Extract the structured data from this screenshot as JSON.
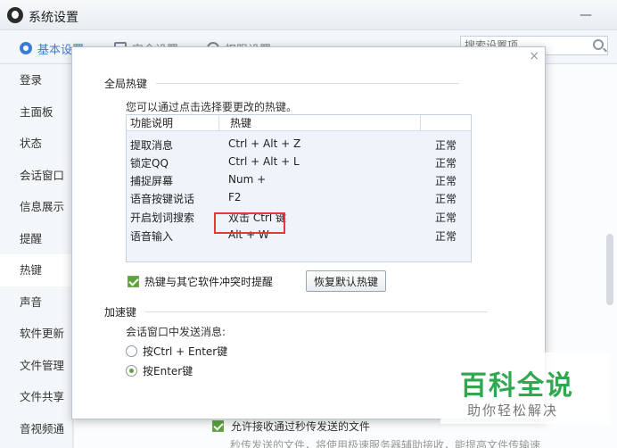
{
  "window": {
    "title": "系统设置",
    "minimize": "—"
  },
  "topnav": {
    "tabs": [
      {
        "label": "基本设置",
        "active": true
      },
      {
        "label": "安全设置",
        "active": false
      },
      {
        "label": "权限设置",
        "active": false
      }
    ],
    "search_placeholder": "搜索设置项"
  },
  "sidebar": {
    "items": [
      {
        "label": "登录"
      },
      {
        "label": "主面板"
      },
      {
        "label": "状态"
      },
      {
        "label": "会话窗口"
      },
      {
        "label": "信息展示"
      },
      {
        "label": "提醒"
      },
      {
        "label": "热键"
      },
      {
        "label": "声音"
      },
      {
        "label": "软件更新"
      },
      {
        "label": "文件管理"
      },
      {
        "label": "文件共享"
      },
      {
        "label": "音视频通话"
      }
    ],
    "active_index": 6
  },
  "dialog": {
    "close": "×",
    "global_hotkeys": {
      "title": "全局热键",
      "description": "您可以通过点击选择要更改的热键。",
      "columns": [
        "功能说明",
        "热键"
      ],
      "rows": [
        {
          "name": "提取消息",
          "key": "Ctrl + Alt + Z",
          "state": "正常"
        },
        {
          "name": "锁定QQ",
          "key": "Ctrl + Alt + L",
          "state": "正常"
        },
        {
          "name": "捕捉屏幕",
          "key": "Num +",
          "state": "正常"
        },
        {
          "name": "语音按键说话",
          "key": "F2",
          "state": "正常"
        },
        {
          "name": "开启划词搜索",
          "key": "双击 Ctrl 键",
          "state": "正常"
        },
        {
          "name": "语音输入",
          "key": "Alt + W",
          "state": "正常"
        }
      ],
      "conflict_check": "热键与其它软件冲突时提醒",
      "restore_button": "恢复默认热键"
    },
    "accelerator": {
      "title": "加速键",
      "send_label": "会话窗口中发送消息:",
      "options": [
        {
          "label": "按Ctrl + Enter键",
          "selected": false
        },
        {
          "label": "按Enter键",
          "selected": true
        }
      ]
    }
  },
  "background": {
    "check_label": "允许接收通过秒传发送的文件",
    "note": "秒传发送的文件，将使用极速服务器辅助接收，能提高文件传输速"
  },
  "watermark": {
    "main": "百科全说",
    "sub": "助你轻松解决"
  },
  "colors": {
    "accent": "#3a7bd5",
    "check_green": "#5aa43a",
    "highlight_red": "#e53935"
  }
}
